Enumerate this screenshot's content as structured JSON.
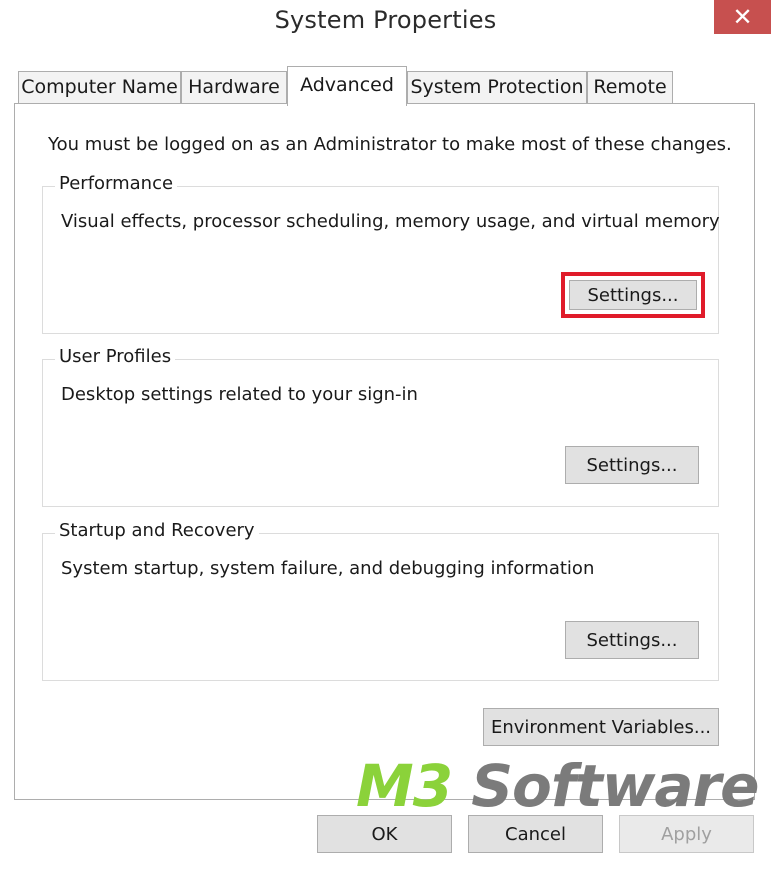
{
  "window": {
    "title": "System Properties",
    "close_glyph": "✕"
  },
  "tabs": [
    {
      "label": "Computer Name",
      "active": false
    },
    {
      "label": "Hardware",
      "active": false
    },
    {
      "label": "Advanced",
      "active": true
    },
    {
      "label": "System Protection",
      "active": false
    },
    {
      "label": "Remote",
      "active": false
    }
  ],
  "notice": "You must be logged on as an Administrator to make most of these changes.",
  "groups": {
    "performance": {
      "title": "Performance",
      "description": "Visual effects, processor scheduling, memory usage, and virtual memory",
      "button_label": "Settings..."
    },
    "user_profiles": {
      "title": "User Profiles",
      "description": "Desktop settings related to your sign-in",
      "button_label": "Settings..."
    },
    "startup_recovery": {
      "title": "Startup and Recovery",
      "description": "System startup, system failure, and debugging information",
      "button_label": "Settings..."
    }
  },
  "environment_button": "Environment Variables...",
  "footer": {
    "ok": "OK",
    "cancel": "Cancel",
    "apply": "Apply"
  },
  "watermark": {
    "part1": "M3",
    "part2": " Software"
  },
  "colors": {
    "highlight": "#e01b2a",
    "close_button": "#c7504f",
    "watermark_green": "#8bd23a",
    "watermark_gray": "#7b7b7b"
  }
}
